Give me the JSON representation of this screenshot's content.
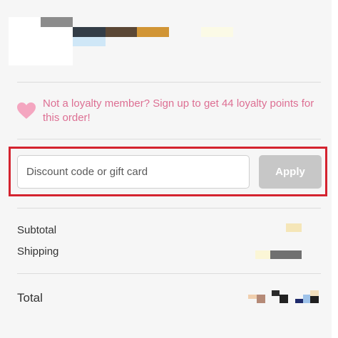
{
  "loyalty": {
    "message": "Not a loyalty member? Sign up to get 44 loyalty points for this order!",
    "icon": "heart-icon",
    "color": "#dd6f93"
  },
  "discount": {
    "placeholder": "Discount code or gift card",
    "value": "",
    "apply_label": "Apply",
    "highlight_color": "#d4232f"
  },
  "summary": {
    "subtotal_label": "Subtotal",
    "shipping_label": "Shipping",
    "total_label": "Total"
  }
}
